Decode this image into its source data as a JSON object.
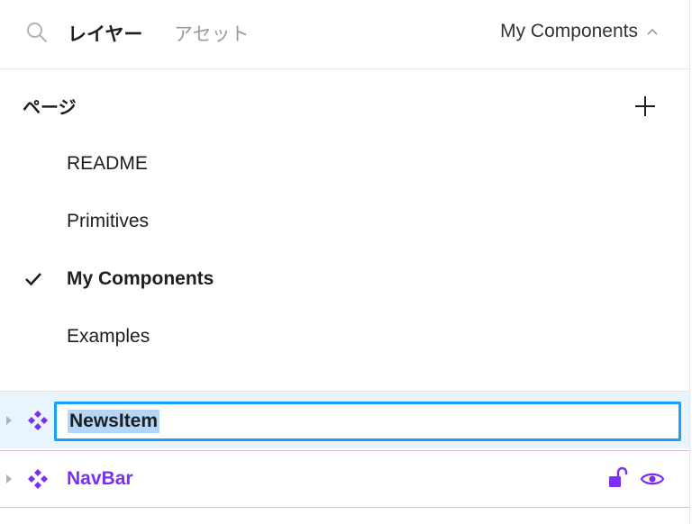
{
  "header": {
    "tabs": [
      {
        "label": "レイヤー",
        "active": true
      },
      {
        "label": "アセット",
        "active": false
      }
    ],
    "current_page": "My Components"
  },
  "pages": {
    "title": "ページ",
    "items": [
      {
        "label": "README"
      },
      {
        "label": "Primitives"
      },
      {
        "label": "My Components",
        "active": true
      },
      {
        "label": "Examples"
      }
    ]
  },
  "layers": {
    "rows": [
      {
        "name": "NewsItem",
        "state": "renaming",
        "icon": "component-icon"
      },
      {
        "name": "NavBar",
        "state": "hover",
        "icon": "component-icon"
      }
    ]
  },
  "colors": {
    "accent": "#18a0fb",
    "component": "#7b2ff2",
    "selection_bg": "#e9f5fe",
    "text_highlight": "#b3d7fb"
  }
}
